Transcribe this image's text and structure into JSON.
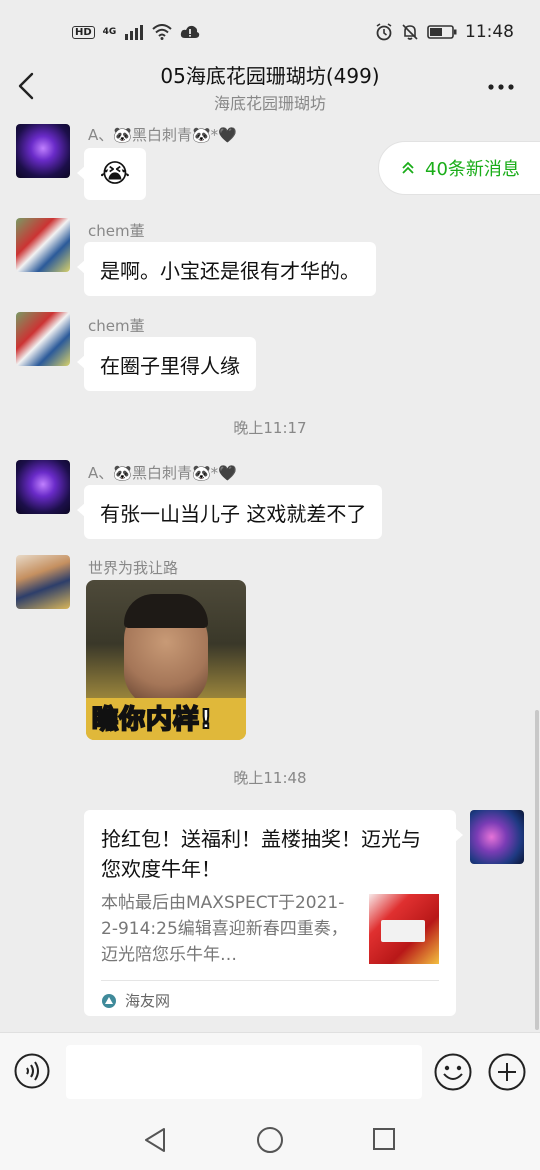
{
  "status_bar": {
    "hd": "HD",
    "network": "4G",
    "time": "11:48"
  },
  "header": {
    "title": "05海底花园珊瑚坊(499)",
    "subtitle": "海底花园珊瑚坊"
  },
  "new_messages": {
    "label": "40条新消息"
  },
  "messages": [
    {
      "sender": "A、🐼黑白刺青🐼*🖤",
      "text": "😭"
    },
    {
      "sender": "chem董",
      "text": "是啊。小宝还是很有才华的。"
    },
    {
      "sender": "chem董",
      "text": "在圈子里得人缘"
    },
    {
      "sender": "A、🐼黑白刺青🐼*🖤",
      "text": "有张一山当儿子 这戏就差不了"
    },
    {
      "sender": "世界为我让路",
      "sticker_caption": "瞧你内样!"
    }
  ],
  "timestamps": [
    "晚上11:17",
    "晚上11:48"
  ],
  "link_card": {
    "title": "抢红包！送福利！盖楼抽奖！迈光与您欢度牛年！",
    "description": "本帖最后由MAXSPECT于2021-2-914:25编辑喜迎新春四重奏，迈光陪您乐牛年…",
    "source": "海友网"
  },
  "input_bar": {
    "placeholder": ""
  },
  "colors": {
    "background": "#ededed",
    "accent_green": "#1aad19",
    "bubble": "#ffffff"
  },
  "icons": [
    "back-arrow-icon",
    "more-icon",
    "voice-icon",
    "emoji-icon",
    "plus-icon",
    "nav-back-icon",
    "nav-home-icon",
    "nav-recent-icon"
  ]
}
